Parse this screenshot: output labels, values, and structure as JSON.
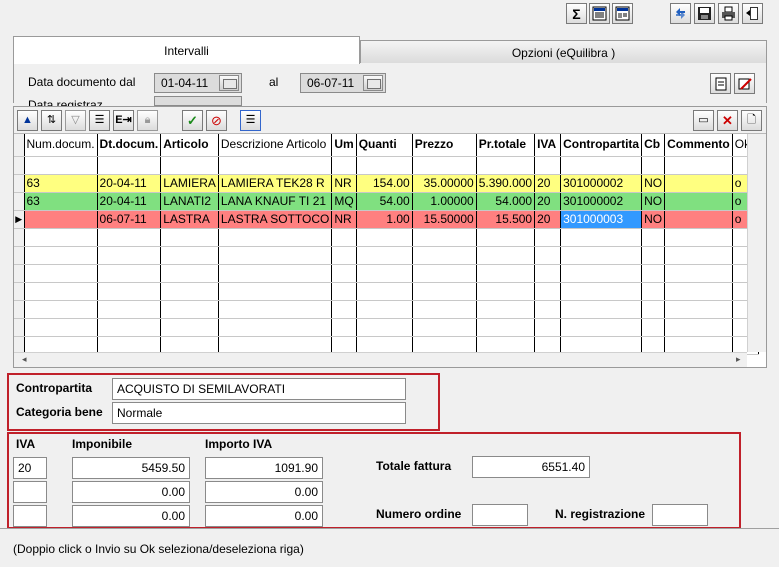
{
  "top_toolbar": {
    "sum": "Σ",
    "icons": [
      "sum-icon",
      "list-view-icon",
      "form-view-icon",
      "refresh-icon",
      "save-icon",
      "print-icon",
      "exit-icon"
    ]
  },
  "tabs": [
    {
      "label": "Intervalli",
      "active": true
    },
    {
      "label": "Opzioni (eQuilibra )",
      "active": false
    }
  ],
  "filters": {
    "data_documento_label": "Data documento dal",
    "date_from": "01-04-11",
    "al_label": "al",
    "date_to": "06-07-11",
    "data_registrazione_label": "Data registraz."
  },
  "grid": {
    "columns": [
      "Num.docum.",
      "Dt.docum.",
      "Articolo",
      "Descrizione Articolo",
      "Um",
      "Quanti",
      "Prezzo",
      "Pr.totale",
      "IVA",
      "Contropartita",
      "Cb",
      "Commento",
      "Ok"
    ],
    "rows": [
      {
        "style": "white",
        "cells": [
          "",
          "",
          "",
          "",
          "",
          "",
          "",
          "",
          "",
          "",
          "",
          "",
          ""
        ]
      },
      {
        "style": "yellow",
        "cells": [
          "63",
          "20-04-11",
          "LAMIERA",
          "LAMIERA TEK28 R",
          "NR",
          "154.00",
          "35.00000",
          "5.390.000",
          "20",
          "301000002",
          "NO",
          "",
          "o"
        ]
      },
      {
        "style": "green",
        "cells": [
          "63",
          "20-04-11",
          "LANATI2",
          "LANA KNAUF TI 21",
          "MQ",
          "54.00",
          "1.00000",
          "54.000",
          "20",
          "301000002",
          "NO",
          "",
          "o"
        ]
      },
      {
        "style": "red",
        "cells": [
          "",
          "06-07-11",
          "LASTRA",
          "LASTRA SOTTOCO",
          "NR",
          "1.00",
          "15.50000",
          "15.500",
          "20",
          "301000003",
          "NO",
          "",
          "o"
        ]
      }
    ]
  },
  "details": {
    "contropartita_label": "Contropartita",
    "contropartita_value": "ACQUISTO DI SEMILAVORATI",
    "categoria_label": "Categoria bene",
    "categoria_value": "Normale"
  },
  "iva_section": {
    "iva_label": "IVA",
    "imponibile_label": "Imponibile",
    "importo_iva_label": "Importo IVA",
    "rows": [
      {
        "iva": "20",
        "imponibile": "5459.50",
        "importo": "1091.90"
      },
      {
        "iva": "",
        "imponibile": "0.00",
        "importo": "0.00"
      },
      {
        "iva": "",
        "imponibile": "0.00",
        "importo": "0.00"
      }
    ],
    "totale_label": "Totale fattura",
    "totale_value": "6551.40",
    "numero_ordine_label": "Numero ordine",
    "numero_ordine_value": "",
    "n_registrazione_label": "N. registrazione",
    "n_registrazione_value": ""
  },
  "status_text": "(Doppio click o Invio su Ok seleziona/deseleziona riga)",
  "colors": {
    "row_yellow": "#ffff80",
    "row_green": "#80e080",
    "row_red": "#ff8080",
    "selection": "#3399ff",
    "highlight_border": "#c0202a"
  }
}
